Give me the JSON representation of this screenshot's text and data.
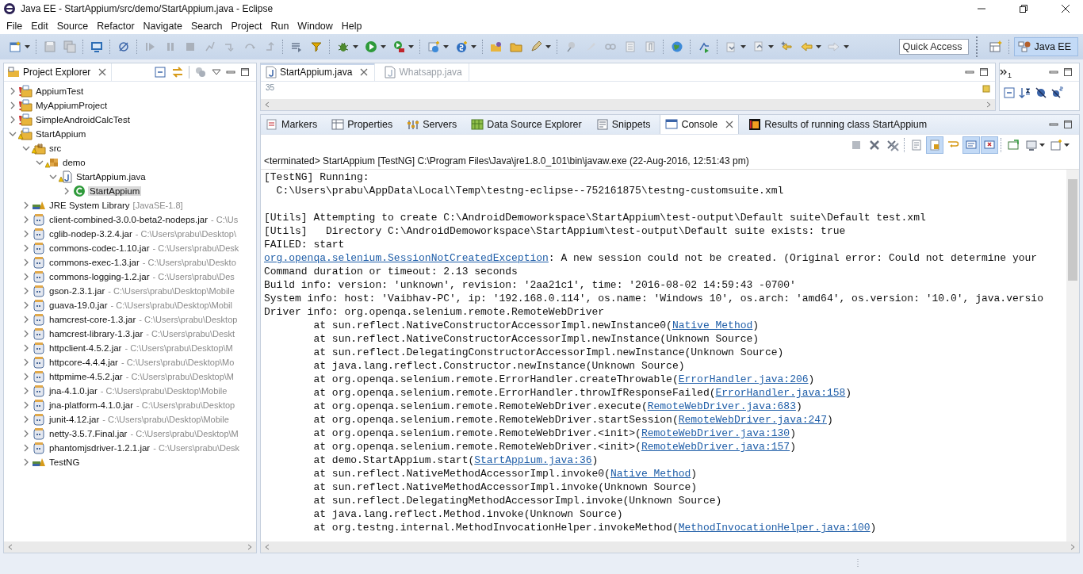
{
  "window": {
    "title": "Java EE - StartAppium/src/demo/StartAppium.java - Eclipse"
  },
  "menu": [
    "File",
    "Edit",
    "Source",
    "Refactor",
    "Navigate",
    "Search",
    "Project",
    "Run",
    "Window",
    "Help"
  ],
  "quick_access": {
    "placeholder": "Quick Access"
  },
  "perspective": {
    "label": "Java EE",
    "selected": true
  },
  "project_explorer": {
    "title": "Project Explorer",
    "tree": [
      {
        "label": "AppiumTest",
        "kind": "project",
        "error": true,
        "warning": false,
        "expanded": false,
        "selected": false
      },
      {
        "label": "MyAppiumProject",
        "kind": "project",
        "error": true,
        "warning": false,
        "expanded": false,
        "selected": false
      },
      {
        "label": "SimpleAndroidCalcTest",
        "kind": "project",
        "error": true,
        "warning": false,
        "expanded": false,
        "selected": false
      },
      {
        "label": "StartAppium",
        "kind": "project",
        "error": false,
        "warning": true,
        "expanded": true,
        "selected": false,
        "children": [
          {
            "label": "src",
            "kind": "source",
            "error": false,
            "warning": true,
            "expanded": true,
            "selected": false,
            "children": [
              {
                "label": "demo",
                "kind": "package",
                "error": false,
                "warning": true,
                "expanded": true,
                "selected": false,
                "children": [
                  {
                    "label": "StartAppium.java",
                    "kind": "java",
                    "error": false,
                    "warning": true,
                    "expanded": true,
                    "selected": false,
                    "children": [
                      {
                        "label": "StartAppium",
                        "kind": "class",
                        "error": false,
                        "warning": false,
                        "expanded": false,
                        "selected": true
                      }
                    ]
                  }
                ]
              }
            ]
          },
          {
            "label": "JRE System Library",
            "decoration": "[JavaSE-1.8]",
            "kind": "library",
            "error": false,
            "warning": false,
            "expanded": false,
            "selected": false
          },
          {
            "label": "client-combined-3.0.0-beta2-nodeps.jar",
            "decoration": "- C:\\Us",
            "kind": "jar",
            "error": false,
            "warning": false,
            "expanded": false,
            "selected": false
          },
          {
            "label": "cglib-nodep-3.2.4.jar",
            "decoration": "- C:\\Users\\prabu\\Desktop\\",
            "kind": "jar",
            "error": false,
            "warning": false,
            "expanded": false,
            "selected": false
          },
          {
            "label": "commons-codec-1.10.jar",
            "decoration": "- C:\\Users\\prabu\\Desk",
            "kind": "jar",
            "error": false,
            "warning": false,
            "expanded": false,
            "selected": false
          },
          {
            "label": "commons-exec-1.3.jar",
            "decoration": "- C:\\Users\\prabu\\Deskto",
            "kind": "jar",
            "error": false,
            "warning": false,
            "expanded": false,
            "selected": false
          },
          {
            "label": "commons-logging-1.2.jar",
            "decoration": "- C:\\Users\\prabu\\Des",
            "kind": "jar",
            "error": false,
            "warning": false,
            "expanded": false,
            "selected": false
          },
          {
            "label": "gson-2.3.1.jar",
            "decoration": "- C:\\Users\\prabu\\Desktop\\Mobile",
            "kind": "jar",
            "error": false,
            "warning": false,
            "expanded": false,
            "selected": false
          },
          {
            "label": "guava-19.0.jar",
            "decoration": "- C:\\Users\\prabu\\Desktop\\Mobil",
            "kind": "jar",
            "error": false,
            "warning": false,
            "expanded": false,
            "selected": false
          },
          {
            "label": "hamcrest-core-1.3.jar",
            "decoration": "- C:\\Users\\prabu\\Desktop",
            "kind": "jar",
            "error": false,
            "warning": false,
            "expanded": false,
            "selected": false
          },
          {
            "label": "hamcrest-library-1.3.jar",
            "decoration": "- C:\\Users\\prabu\\Deskt",
            "kind": "jar",
            "error": false,
            "warning": false,
            "expanded": false,
            "selected": false
          },
          {
            "label": "httpclient-4.5.2.jar",
            "decoration": "- C:\\Users\\prabu\\Desktop\\M",
            "kind": "jar",
            "error": false,
            "warning": false,
            "expanded": false,
            "selected": false
          },
          {
            "label": "httpcore-4.4.4.jar",
            "decoration": "- C:\\Users\\prabu\\Desktop\\Mo",
            "kind": "jar",
            "error": false,
            "warning": false,
            "expanded": false,
            "selected": false
          },
          {
            "label": "httpmime-4.5.2.jar",
            "decoration": "- C:\\Users\\prabu\\Desktop\\M",
            "kind": "jar",
            "error": false,
            "warning": false,
            "expanded": false,
            "selected": false
          },
          {
            "label": "jna-4.1.0.jar",
            "decoration": "- C:\\Users\\prabu\\Desktop\\Mobile",
            "kind": "jar",
            "error": false,
            "warning": false,
            "expanded": false,
            "selected": false
          },
          {
            "label": "jna-platform-4.1.0.jar",
            "decoration": "- C:\\Users\\prabu\\Desktop",
            "kind": "jar",
            "error": false,
            "warning": false,
            "expanded": false,
            "selected": false
          },
          {
            "label": "junit-4.12.jar",
            "decoration": "- C:\\Users\\prabu\\Desktop\\Mobile",
            "kind": "jar",
            "error": false,
            "warning": false,
            "expanded": false,
            "selected": false
          },
          {
            "label": "netty-3.5.7.Final.jar",
            "decoration": "- C:\\Users\\prabu\\Desktop\\M",
            "kind": "jar",
            "error": false,
            "warning": false,
            "expanded": false,
            "selected": false
          },
          {
            "label": "phantomjsdriver-1.2.1.jar",
            "decoration": "- C:\\Users\\prabu\\Desk",
            "kind": "jar",
            "error": false,
            "warning": false,
            "expanded": false,
            "selected": false
          },
          {
            "label": "TestNG",
            "kind": "library",
            "error": false,
            "warning": false,
            "expanded": false,
            "selected": false
          }
        ]
      }
    ]
  },
  "editor": {
    "tabs": [
      {
        "label": "StartAppium.java",
        "selected": true
      },
      {
        "label": "Whatsapp.java",
        "selected": false
      }
    ],
    "line_number": "35"
  },
  "outline": {
    "hidden_count": "1"
  },
  "bottom_panel": {
    "tabs": [
      {
        "label": "Markers",
        "kind": "markers",
        "selected": false
      },
      {
        "label": "Properties",
        "kind": "properties",
        "selected": false
      },
      {
        "label": "Servers",
        "kind": "servers",
        "selected": false
      },
      {
        "label": "Data Source Explorer",
        "kind": "datasource",
        "selected": false
      },
      {
        "label": "Snippets",
        "kind": "snippets",
        "selected": false
      },
      {
        "label": "Console",
        "kind": "console",
        "selected": true
      },
      {
        "label": "Results of running class StartAppium",
        "kind": "testng",
        "selected": false
      }
    ],
    "console": {
      "status": "<terminated> StartAppium [TestNG] C:\\Program Files\\Java\\jre1.8.0_101\\bin\\javaw.exe (22-Aug-2016, 12:51:43 pm)",
      "blocks": [
        [
          [
            {
              "text": "[TestNG] Running:",
              "link": false
            }
          ],
          [
            {
              "text": "  C:\\Users\\prabu\\AppData\\Local\\Temp\\testng-eclipse--752161875\\testng-customsuite.xml",
              "link": false
            }
          ]
        ],
        [
          [
            {
              "text": "[Utils] Attempting to create C:\\AndroidDemoworkspace\\StartAppium\\test-output\\Default suite\\Default test.xml",
              "link": false
            }
          ],
          [
            {
              "text": "[Utils]   Directory C:\\AndroidDemoworkspace\\StartAppium\\test-output\\Default suite exists: true",
              "link": false
            }
          ],
          [
            {
              "text": "FAILED: start",
              "link": false
            }
          ],
          [
            {
              "text": "org.openqa.selenium.SessionNotCreatedException",
              "link": true
            },
            {
              "text": ": A new session could not be created. (Original error: Could not determine your",
              "link": false
            }
          ],
          [
            {
              "text": "Command duration or timeout: 2.13 seconds",
              "link": false
            }
          ],
          [
            {
              "text": "Build info: version: 'unknown', revision: '2aa21c1', time: '2016-08-02 14:59:43 -0700'",
              "link": false
            }
          ],
          [
            {
              "text": "System info: host: 'Vaibhav-PC', ip: '192.168.0.114', os.name: 'Windows 10', os.arch: 'amd64', os.version: '10.0', java.versio",
              "link": false
            }
          ],
          [
            {
              "text": "Driver info: org.openqa.selenium.remote.RemoteWebDriver",
              "link": false
            }
          ],
          [
            {
              "text": "\tat sun.reflect.NativeConstructorAccessorImpl.newInstance0(",
              "link": false
            },
            {
              "text": "Native Method",
              "link": true
            },
            {
              "text": ")",
              "link": false
            }
          ],
          [
            {
              "text": "\tat sun.reflect.NativeConstructorAccessorImpl.newInstance(Unknown Source)",
              "link": false
            }
          ],
          [
            {
              "text": "\tat sun.reflect.DelegatingConstructorAccessorImpl.newInstance(Unknown Source)",
              "link": false
            }
          ],
          [
            {
              "text": "\tat java.lang.reflect.Constructor.newInstance(Unknown Source)",
              "link": false
            }
          ],
          [
            {
              "text": "\tat org.openqa.selenium.remote.ErrorHandler.createThrowable(",
              "link": false
            },
            {
              "text": "ErrorHandler.java:206",
              "link": true
            },
            {
              "text": ")",
              "link": false
            }
          ],
          [
            {
              "text": "\tat org.openqa.selenium.remote.ErrorHandler.throwIfResponseFailed(",
              "link": false
            },
            {
              "text": "ErrorHandler.java:158",
              "link": true
            },
            {
              "text": ")",
              "link": false
            }
          ],
          [
            {
              "text": "\tat org.openqa.selenium.remote.RemoteWebDriver.execute(",
              "link": false
            },
            {
              "text": "RemoteWebDriver.java:683",
              "link": true
            },
            {
              "text": ")",
              "link": false
            }
          ],
          [
            {
              "text": "\tat org.openqa.selenium.remote.RemoteWebDriver.startSession(",
              "link": false
            },
            {
              "text": "RemoteWebDriver.java:247",
              "link": true
            },
            {
              "text": ")",
              "link": false
            }
          ],
          [
            {
              "text": "\tat org.openqa.selenium.remote.RemoteWebDriver.<init>(",
              "link": false
            },
            {
              "text": "RemoteWebDriver.java:130",
              "link": true
            },
            {
              "text": ")",
              "link": false
            }
          ],
          [
            {
              "text": "\tat org.openqa.selenium.remote.RemoteWebDriver.<init>(",
              "link": false
            },
            {
              "text": "RemoteWebDriver.java:157",
              "link": true
            },
            {
              "text": ")",
              "link": false
            }
          ],
          [
            {
              "text": "\tat demo.StartAppium.start(",
              "link": false
            },
            {
              "text": "StartAppium.java:36",
              "link": true
            },
            {
              "text": ")",
              "link": false
            }
          ],
          [
            {
              "text": "\tat sun.reflect.NativeMethodAccessorImpl.invoke0(",
              "link": false
            },
            {
              "text": "Native Method",
              "link": true
            },
            {
              "text": ")",
              "link": false
            }
          ],
          [
            {
              "text": "\tat sun.reflect.NativeMethodAccessorImpl.invoke(Unknown Source)",
              "link": false
            }
          ],
          [
            {
              "text": "\tat sun.reflect.DelegatingMethodAccessorImpl.invoke(Unknown Source)",
              "link": false
            }
          ],
          [
            {
              "text": "\tat java.lang.reflect.Method.invoke(Unknown Source)",
              "link": false
            }
          ],
          [
            {
              "text": "\tat org.testng.internal.MethodInvocationHelper.invokeMethod(",
              "link": false
            },
            {
              "text": "MethodInvocationHelper.java:100",
              "link": true
            },
            {
              "text": ")",
              "link": false
            }
          ]
        ]
      ]
    }
  }
}
